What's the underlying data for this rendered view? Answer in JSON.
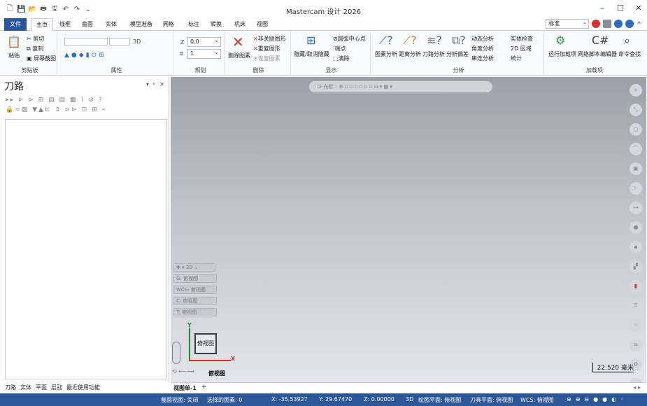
{
  "app": {
    "title": "Mastercam 设计 2026"
  },
  "tabs": [
    "文件",
    "主页",
    "线框",
    "曲面",
    "实体",
    "模型准备",
    "网格",
    "标注",
    "转换",
    "机床",
    "视图"
  ],
  "topright": {
    "dropdown": "标准"
  },
  "ribbon": {
    "clipboard": {
      "label": "剪贴板",
      "paste": "粘贴",
      "cut": "剪切",
      "copy": "复制",
      "screenshot": "屏幕截图"
    },
    "properties": {
      "label": "属性",
      "dim": "3D"
    },
    "plan": {
      "label": "规划",
      "z_value": "0.0",
      "level": "1"
    },
    "delete": {
      "label": "删除",
      "delete_entity": "删除图素",
      "unrelated": "非关联图形",
      "dup": "重复图形",
      "restore": "恢复图素"
    },
    "display": {
      "label": "显示",
      "hide": "隐藏/取消隐藏",
      "arc_center": "圆弧中心点",
      "endpoints": "端点",
      "clear": "清除"
    },
    "analysis": {
      "label": "分析",
      "entity": "图素分析",
      "distance": "距离分析",
      "toolpath": "刀路分析",
      "chain": "分析偏差",
      "dynamic": "动态分析",
      "angle": "角度分析",
      "seg": "串连分析",
      "solid": "实体检查",
      "area2d": "2D 区域",
      "stats": "统计"
    },
    "addins": {
      "label": "加载项",
      "run": "运行加载项",
      "net": "网络脚本编辑器",
      "find": "命令查找"
    }
  },
  "leftpanel": {
    "title": "刀路"
  },
  "bottomtabs": [
    "刀路",
    "实体",
    "平面",
    "层别",
    "最近使用功能"
  ],
  "viewport": {
    "mode": "3D",
    "g": "G: 俯视图",
    "wcs": "WCS: 俯视图",
    "c": "C: 俯视图",
    "t": "T: 俯视图",
    "cube_label": "俯视图",
    "view_name": "俯视图",
    "scale": "22.520 毫米",
    "toolbar_label": "光标"
  },
  "viewtabs": {
    "active": "视图单-1",
    "add": "+"
  },
  "status": {
    "section": "截面视图: 关闭",
    "selected": "选择的图素: 0",
    "x": "X: -35.53927",
    "y": "Y: 29.67470",
    "z": "Z: 0.00000",
    "mode": "3D",
    "plane": "绘图平面: 俯视图",
    "tool": "刀具平面: 俯视图",
    "wcs": "WCS: 俯视图"
  }
}
